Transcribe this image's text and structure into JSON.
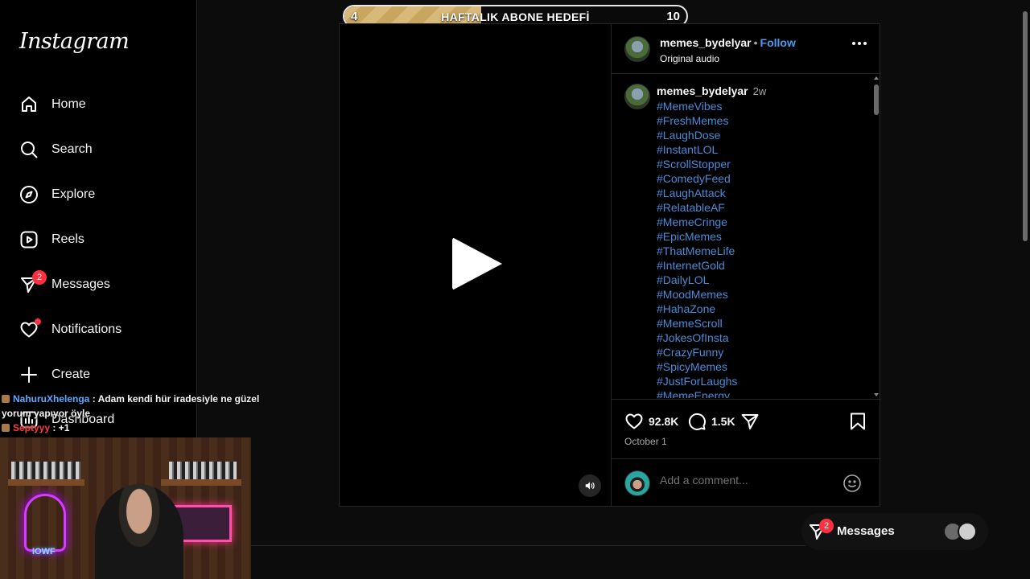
{
  "sidebar": {
    "logo": "Instagram",
    "items": [
      {
        "label": "Home",
        "icon": "home-icon"
      },
      {
        "label": "Search",
        "icon": "search-icon"
      },
      {
        "label": "Explore",
        "icon": "compass-icon"
      },
      {
        "label": "Reels",
        "icon": "reels-icon"
      },
      {
        "label": "Messages",
        "icon": "messenger-icon",
        "badge": "2"
      },
      {
        "label": "Notifications",
        "icon": "heart-icon"
      },
      {
        "label": "Create",
        "icon": "plus-icon"
      },
      {
        "label": "Dashboard",
        "icon": "dashboard-icon"
      }
    ]
  },
  "goal": {
    "start": "4",
    "title": "HAFTALIK ABONE HEDEFİ",
    "end": "10",
    "progress": 0.4
  },
  "post": {
    "author": "memes_bydelyar",
    "follow_label": "Follow",
    "audio": "Original audio",
    "caption": {
      "author": "memes_bydelyar",
      "time": "2w",
      "hashtags": [
        "#MemeVibes",
        "#FreshMemes",
        "#LaughDose",
        "#InstantLOL",
        "#ScrollStopper",
        "#ComedyFeed",
        "#LaughAttack",
        "#RelatableAF",
        "#MemeCringe",
        "#EpicMemes",
        "#ThatMemeLife",
        "#InternetGold",
        "#DailyLOL",
        "#MoodMemes",
        "#HahaZone",
        "#MemeScroll",
        "#JokesOfInsta",
        "#CrazyFunny",
        "#SpicyMemes",
        "#JustForLaughs",
        "#MemeEnergy"
      ]
    },
    "likes": "92.8K",
    "comments": "1.5K",
    "date": "October 1",
    "comment_placeholder": "Add a comment..."
  },
  "messages_pill": {
    "label": "Messages",
    "badge": "2"
  },
  "chat": [
    {
      "user": "NahuruXhelenga",
      "text": ": Adam kendi hür iradesiyle ne güzel yorum yapıyor öyle"
    },
    {
      "user": "Septyyy",
      "text": ": +1"
    }
  ],
  "webcam": {
    "logo_text": "IOWF"
  },
  "colors": {
    "accent": "#4a9cf0",
    "badge": "#ff3040",
    "hashtag": "#4a8bd8"
  }
}
